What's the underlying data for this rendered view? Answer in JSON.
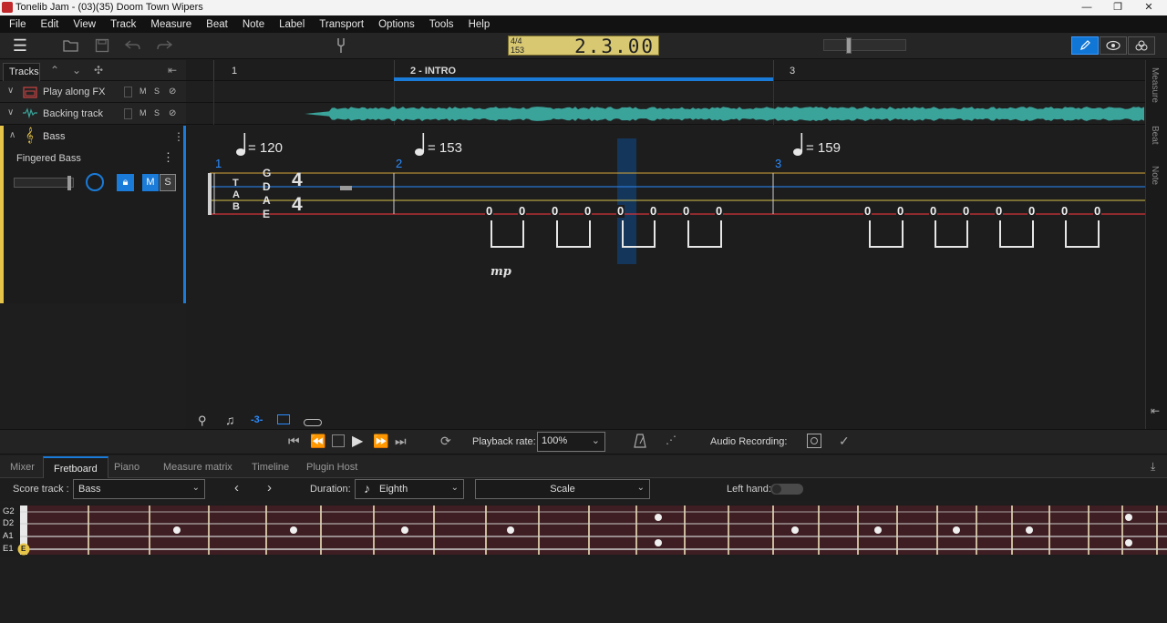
{
  "window": {
    "title": "Tonelib Jam - (03)(35) Doom Town  Wipers",
    "minimize": "—",
    "restore": "❐",
    "close": "✕"
  },
  "menu": [
    "File",
    "Edit",
    "View",
    "Track",
    "Measure",
    "Beat",
    "Note",
    "Label",
    "Transport",
    "Options",
    "Tools",
    "Help"
  ],
  "toolbar": {
    "lcd_timesig": "4/4",
    "lcd_tempo": "153",
    "lcd_value": "2.3.00",
    "icons": [
      "menu-icon",
      "open-folder-icon",
      "save-icon",
      "undo-icon",
      "redo-icon",
      "tuner-fork-icon"
    ]
  },
  "tracks_panel": {
    "tab_label": "Tracks",
    "tracks": [
      {
        "name": "Play along FX",
        "icon": "amp-icon",
        "mute": "M",
        "solo": "S"
      },
      {
        "name": "Backing track",
        "icon": "waveform-icon",
        "mute": "M",
        "solo": "S"
      }
    ],
    "bass": {
      "name": "Bass",
      "instrument": "Fingered Bass",
      "mute": "M",
      "solo": "S"
    }
  },
  "ruler": {
    "measures": [
      {
        "num": "1"
      },
      {
        "num": "2 - INTRO"
      },
      {
        "num": "3"
      }
    ]
  },
  "score": {
    "tempos": [
      "= 120",
      "= 153",
      "= 159"
    ],
    "bar_numbers": [
      "1",
      "2",
      "3"
    ],
    "tab_letters": [
      "T",
      "A",
      "B"
    ],
    "string_names": [
      "G",
      "D",
      "A",
      "E"
    ],
    "time_sig": [
      "4",
      "4"
    ],
    "fret_value": "0",
    "dynamic": "mp",
    "bottom_tools": [
      "search-icon",
      "note-icon",
      "-3-",
      "layout-icon",
      "pill-icon"
    ]
  },
  "side_tabs": [
    "Measure",
    "Beat",
    "Note"
  ],
  "transport": {
    "playback_rate_label": "Playback rate:",
    "playback_rate_value": "100%",
    "audio_recording_label": "Audio Recording:"
  },
  "bottom_tabs": [
    "Mixer",
    "Fretboard",
    "Piano",
    "Measure matrix",
    "Timeline",
    "Plugin Host"
  ],
  "fretboard_bar": {
    "score_track_label": "Score track :",
    "score_track_value": "Bass",
    "duration_label": "Duration:",
    "duration_value": "Eighth",
    "scale_value": "Scale",
    "left_hand_label": "Left hand:"
  },
  "fretboard": {
    "strings": [
      "G2",
      "D2",
      "A1",
      "E1"
    ],
    "open_note": "E"
  },
  "colors": {
    "accent": "#1a7bd8",
    "bass_track": "#e6c44a",
    "waveform": "#3aa39a",
    "lcd": "#d8c872",
    "fretboard_wood": "#3e1e22"
  }
}
